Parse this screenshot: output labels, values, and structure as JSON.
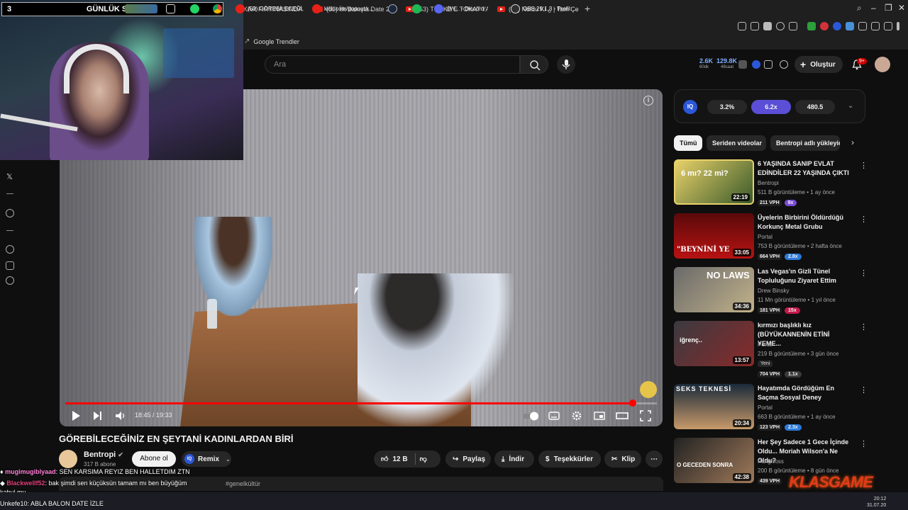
{
  "browser": {
    "tabs": [
      {
        "label": "KAR FIRTINASINDA"
      },
      {
        "label": "(53) İlk Bakışta Date 2. B"
      },
      {
        "label": "(53) TÜRKİYE TOKAT YA"
      },
      {
        "label": "(53) Noldu Ki ¿ | Tam Çe"
      }
    ],
    "new_tab": "+",
    "bookmark": "Google Trendler"
  },
  "overlay": {
    "sub_left": "3",
    "sub_title": "GÜNLÜK SUB",
    "sub_right": "7"
  },
  "header": {
    "search_placeholder": "Ara",
    "stat1_top": "2.6K",
    "stat1_bottom": "60dk",
    "stat2_top": "129.8K",
    "stat2_bottom": "48saat",
    "create_label": "Oluştur",
    "notif_badge": "9+"
  },
  "player": {
    "time": "18:45 / 19:33",
    "progress_fraction": 0.959
  },
  "video": {
    "title": "GÖREBİLECEĞİNİZ EN ŞEYTANİ KADINLARDAN BİRİ",
    "channel": "Bentropi",
    "subscribers": "317 B abone",
    "subscribe_label": "Abone ol",
    "remix_label": "Remix",
    "likes": "12 B",
    "share_label": "Paylaş",
    "download_label": "İndir",
    "thanks_label": "Teşekkürler",
    "clip_label": "Klip",
    "desc_tags": "#genelkültür"
  },
  "iq_panel": {
    "logo": "IQ",
    "values": [
      "3.2%",
      "6.2x",
      "480.5"
    ]
  },
  "chips": [
    "Tümü",
    "Seriden videolar",
    "Bentropi adlı yükleyic"
  ],
  "recommendations": [
    {
      "title": "6 YAŞINDA SANIP EVLAT EDİNDİLER 22 YAŞINDA ÇIKTI",
      "channel": "Bentropi",
      "meta": "511 B görüntüleme • 1 ay önce",
      "vph": "211 VPH",
      "mult": "8x",
      "duration": "22:19",
      "thumb_text": "6 mı?   22 mi?",
      "color": "#7a49d6"
    },
    {
      "title": "Üyelerin Birbirini Öldürdüğü Korkunç Metal Grubu",
      "channel": "Portal",
      "meta": "753 B görüntüleme • 2 hafta önce",
      "vph": "664 VPH",
      "mult": "2.8x",
      "duration": "33:05",
      "thumb_text": "\"BEYNİNİ YE",
      "color": "#2b7ad8"
    },
    {
      "title": "Las Vegas'ın Gizli Tünel Topluluğunu Ziyaret Ettim",
      "channel": "Drew Binsky",
      "meta": "11 Mn görüntüleme • 1 yıl önce",
      "vph": "181 VPH",
      "mult": "15x",
      "duration": "34:36",
      "thumb_text": "NO LAWS",
      "color": "#c21a4a"
    },
    {
      "title": "kırmızı başlıklı kız (BÜYÜKANNENİN ETİNİ YEME...",
      "channel": "Portal",
      "meta": "219 B görüntüleme • 3 gün önce",
      "badge": "Yeni",
      "vph": "704 VPH",
      "mult": "1.1x",
      "duration": "13:57",
      "thumb_text": "iğrenç..",
      "color": "#3a3a3a"
    },
    {
      "title": "Hayatımda Gördüğüm En Saçma Sosyal Deney",
      "channel": "Portal",
      "meta": "663 B görüntüleme • 1 ay önce",
      "vph": "123 VPH",
      "mult": "2.3x",
      "duration": "20:34",
      "thumb_text": "SEKS TEKNESİ",
      "color": "#2b7ad8"
    },
    {
      "title": "Her Şey Sadece 1 Gece İçinde Oldu... Moriah Wilson'a Ne Oldu?",
      "channel": "Pangwoss",
      "meta": "200 B görüntüleme • 8 gün önce",
      "vph": "439 VPH",
      "mult": "",
      "duration": "42:38",
      "thumb_text": "O GECEDEN SONRA",
      "color": "#3a3a3a"
    }
  ],
  "chat": [
    {
      "user": "mugimugiblyaad",
      "text": ": SEN KARSIMA REYIZ BEN HALLETDIM ZTN"
    },
    {
      "user": "Blackwellf52",
      "text": ": bak şimdi sen küçüksün tamam mı ben büyüğüm"
    },
    {
      "user": "",
      "text": "kabul mu"
    },
    {
      "user": "Unkefe10",
      "text": ": ABLA BALON DATE İZLE"
    }
  ],
  "taskbar": {
    "items": [
      "(53) GÖREBİLECEĞİ...",
      "kick.com/popout/r...",
      "@Y... - Discord",
      "OBS 29.1.3 - Profil: ..."
    ],
    "clock_time": "20:12",
    "clock_date": "31.07.20"
  },
  "watermark": "KLASGAME"
}
